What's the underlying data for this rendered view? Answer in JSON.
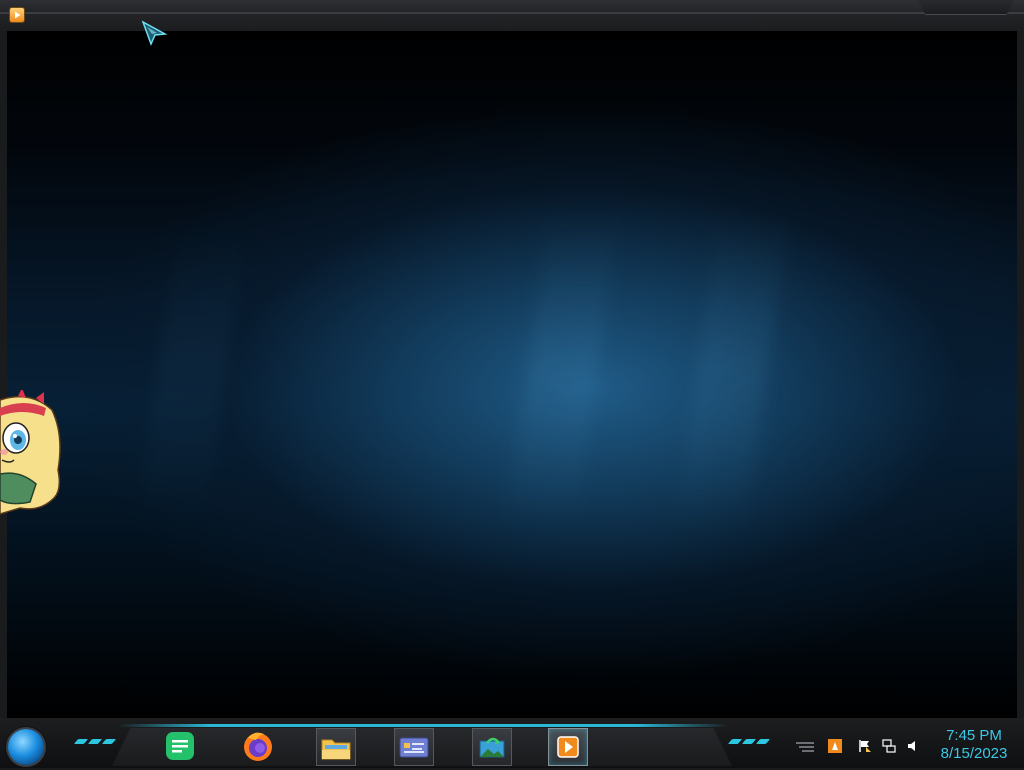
{
  "window": {
    "app_icon": "media-player-icon"
  },
  "viewer": {
    "content": "video-frame",
    "accent_color": "#1d5b8a"
  },
  "taskbar": {
    "start_icon": "start-orb-icon",
    "pinned_apps": [
      {
        "name": "notes-app",
        "icon": "note-icon",
        "color": "#22c16a"
      },
      {
        "name": "firefox",
        "icon": "firefox-icon",
        "color": "#ff7a1a"
      },
      {
        "name": "file-explorer",
        "icon": "folder-icon",
        "color": "#f2c14e"
      },
      {
        "name": "id-card-app",
        "icon": "id-card-icon",
        "color": "#6f7fd1"
      },
      {
        "name": "image-viewer",
        "icon": "image-viewer-icon",
        "color": "#3aa0d8"
      },
      {
        "name": "media-player",
        "icon": "media-player-icon",
        "color": "#f08a1c",
        "active": true
      }
    ],
    "tray_icons": [
      "show-hidden-icon",
      "vlc-icon",
      "action-center-flag-icon",
      "network-icon",
      "volume-icon"
    ],
    "clock": {
      "time": "7:45 PM",
      "date": "8/15/2023"
    },
    "accent_color": "#2bc6e0"
  }
}
